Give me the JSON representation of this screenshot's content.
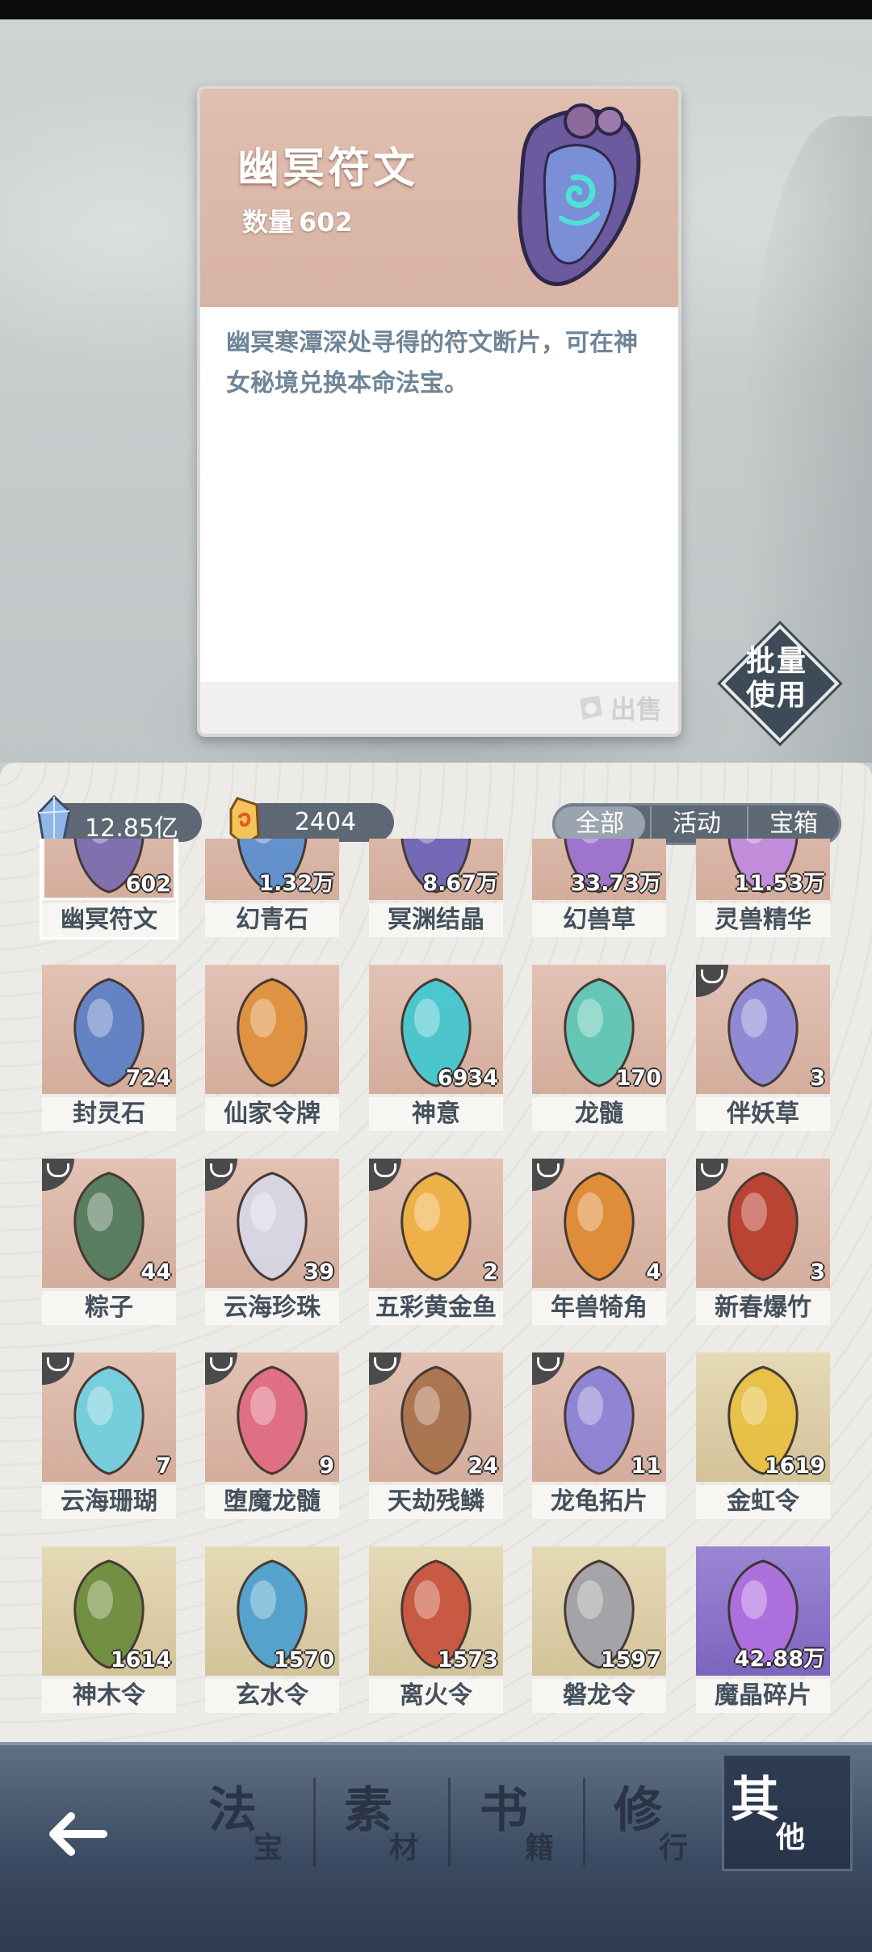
{
  "detail": {
    "title": "幽冥符文",
    "count_label": "数量",
    "count_value": "602",
    "description": "幽冥寒潭深处寻得的符文断片，可在神女秘境兑换本命法宝。",
    "sell_label": "出售"
  },
  "batch_use": {
    "line1": "批量",
    "line2": "使用"
  },
  "currency": {
    "crystal": "12.85亿",
    "jade": "2404"
  },
  "filter_tabs": [
    "全部",
    "活动",
    "宝箱"
  ],
  "items": [
    {
      "name": "幽冥符文",
      "count": "602",
      "icon": "rune-icon"
    },
    {
      "name": "幻青石",
      "count": "1.32万",
      "icon": "stone-icon"
    },
    {
      "name": "冥渊结晶",
      "count": "8.67万",
      "icon": "crystal-icon"
    },
    {
      "name": "幻兽草",
      "count": "33.73万",
      "icon": "herb-icon"
    },
    {
      "name": "灵兽精华",
      "count": "11.53万",
      "icon": "essence-icon"
    },
    {
      "name": "封灵石",
      "count": "724",
      "icon": "seal-stone-icon"
    },
    {
      "name": "仙家令牌",
      "count": "",
      "icon": "token-icon"
    },
    {
      "name": "神意",
      "count": "6934",
      "icon": "spirit-flame-icon"
    },
    {
      "name": "龙髓",
      "count": "170",
      "icon": "dragon-marrow-icon"
    },
    {
      "name": "伴妖草",
      "count": "3",
      "icon": "plant-icon"
    },
    {
      "name": "粽子",
      "count": "44",
      "icon": "zongzi-icon"
    },
    {
      "name": "云海珍珠",
      "count": "39",
      "icon": "pearl-icon"
    },
    {
      "name": "五彩黄金鱼",
      "count": "2",
      "icon": "goldfish-icon"
    },
    {
      "name": "年兽犄角",
      "count": "4",
      "icon": "horn-icon"
    },
    {
      "name": "新春爆竹",
      "count": "3",
      "icon": "firecracker-icon"
    },
    {
      "name": "云海珊瑚",
      "count": "7",
      "icon": "coral-icon"
    },
    {
      "name": "堕魔龙髓",
      "count": "9",
      "icon": "dark-marrow-icon"
    },
    {
      "name": "天劫残鳞",
      "count": "24",
      "icon": "scale-icon"
    },
    {
      "name": "龙龟拓片",
      "count": "11",
      "icon": "rubbing-icon"
    },
    {
      "name": "金虹令",
      "count": "1619",
      "icon": "gold-token-icon"
    },
    {
      "name": "神木令",
      "count": "1614",
      "icon": "wood-token-icon"
    },
    {
      "name": "玄水令",
      "count": "1570",
      "icon": "water-token-icon"
    },
    {
      "name": "离火令",
      "count": "1573",
      "icon": "fire-token-icon"
    },
    {
      "name": "磐龙令",
      "count": "1597",
      "icon": "stone-token-icon"
    },
    {
      "name": "魔晶碎片",
      "count": "42.88万",
      "icon": "magic-shard-icon"
    }
  ],
  "nav": [
    {
      "big": "法",
      "small": "宝"
    },
    {
      "big": "素",
      "small": "材"
    },
    {
      "big": "书",
      "small": "籍"
    },
    {
      "big": "修",
      "small": "行"
    },
    {
      "big": "其",
      "small": "他"
    }
  ],
  "colors": {
    "accent": "#5d6874",
    "card_header": "#d8b3a4",
    "nav": "#3b4b63",
    "text": "#44505c"
  }
}
